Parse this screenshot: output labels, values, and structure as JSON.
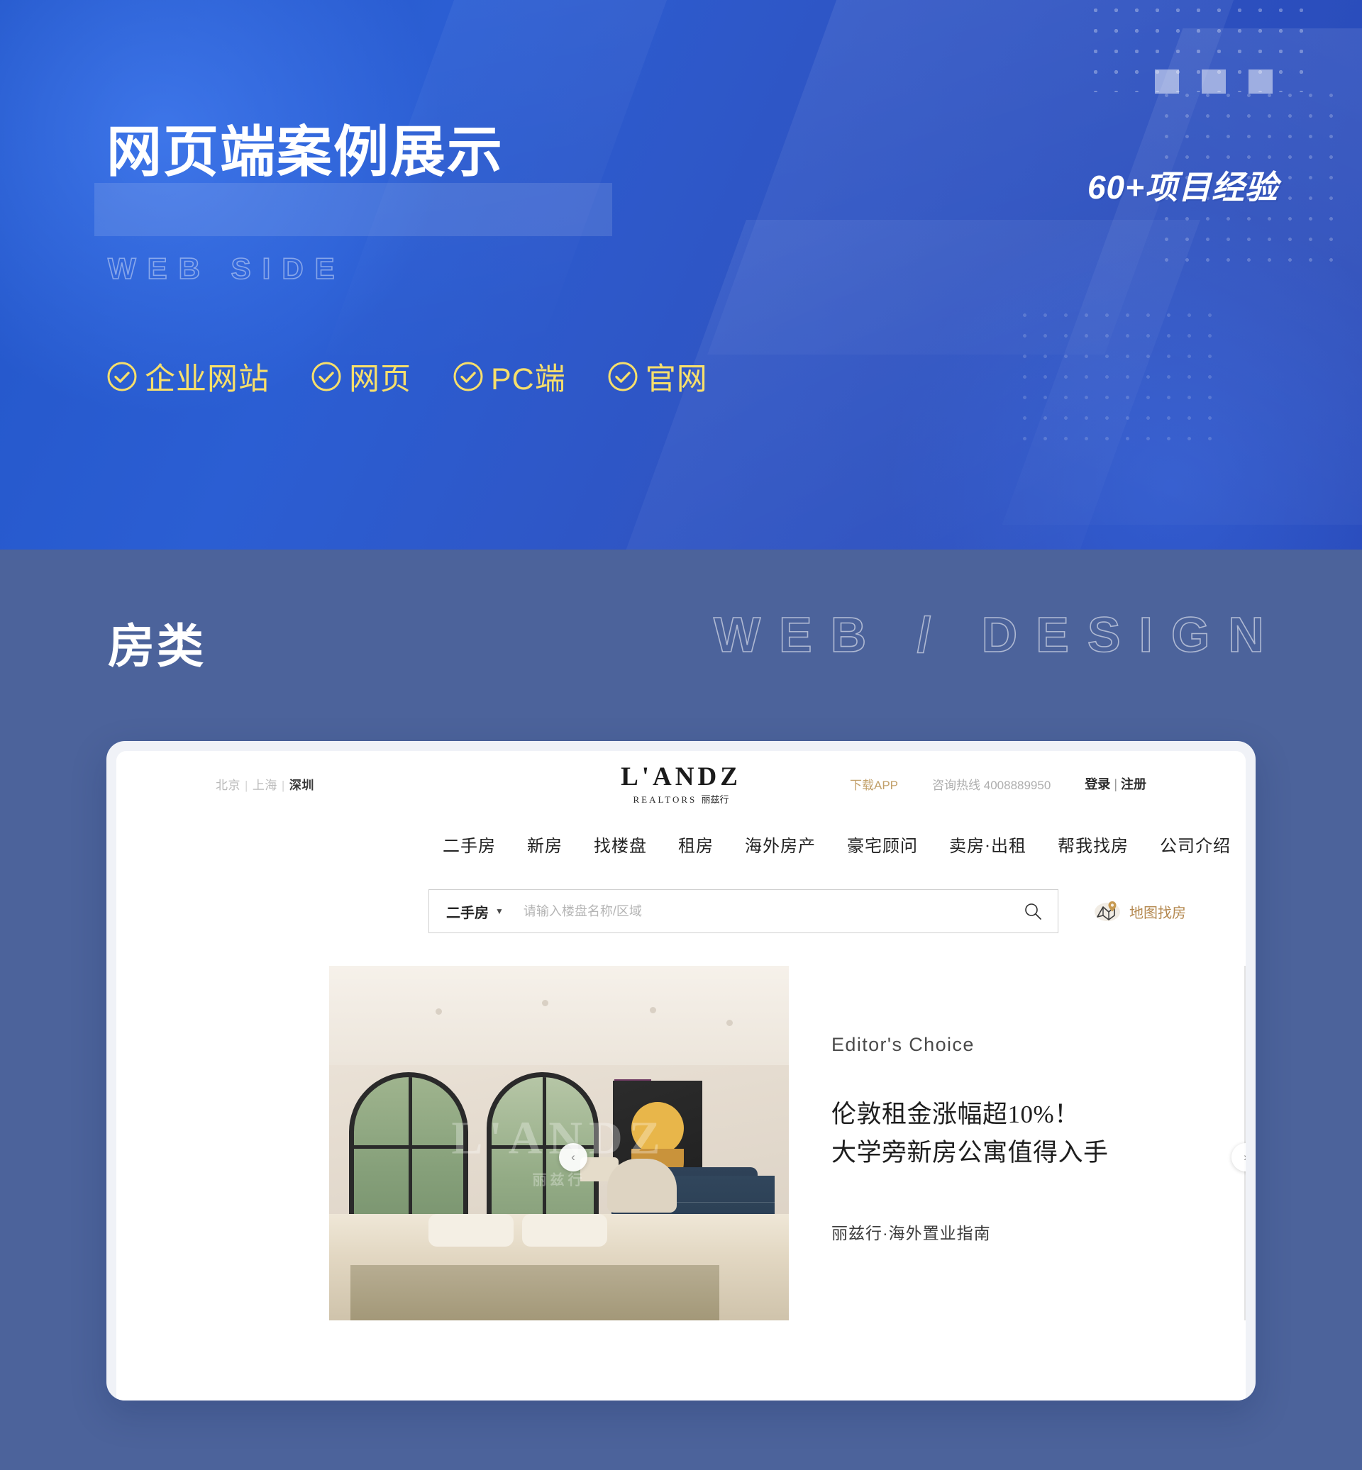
{
  "hero": {
    "title": "网页端案例展示",
    "subtitle": "WEB SIDE",
    "badge": "60+项目经验",
    "features": [
      {
        "label": "企业网站",
        "icon": "check-circle-icon"
      },
      {
        "label": "网页",
        "icon": "check-circle-icon"
      },
      {
        "label": "PC端",
        "icon": "check-circle-icon"
      },
      {
        "label": "官网",
        "icon": "check-circle-icon"
      }
    ],
    "accent_color": "#F7DF6B",
    "background_color": "#2b5ed3"
  },
  "section2": {
    "title": "房类",
    "wordmark": "WEB / DESIGN",
    "background_color": "#4c639b"
  },
  "site": {
    "topbar": {
      "cities": [
        "北京",
        "上海",
        "深圳"
      ],
      "active_city": "深圳",
      "separator": "|",
      "download_app": "下载APP",
      "hotline": "咨询热线 4008889950",
      "login": "登录",
      "auth_separator": "|",
      "register": "注册",
      "gold_color": "#c2a06a"
    },
    "logo": {
      "main": "L'ANDZ",
      "sub_en": "REALTORS",
      "sub_cn": "丽兹行"
    },
    "nav": [
      "二手房",
      "新房",
      "找楼盘",
      "租房",
      "海外房产",
      "豪宅顾问",
      "卖房·出租",
      "帮我找房",
      "公司介绍"
    ],
    "search": {
      "selected_type": "二手房",
      "caret": "▼",
      "placeholder": "请输入楼盘名称/区域",
      "value": "",
      "search_icon": "magnifier-icon",
      "map_link_label": "地图找房",
      "map_link_icon": "map-pin-icon"
    },
    "banner": {
      "photo_watermark": "L'ANDZ",
      "photo_watermark_sub": "丽兹行",
      "eyebrow": "Editor's Choice",
      "headline_line1": "伦敦租金涨幅超10%！",
      "headline_line2": "大学旁新房公寓值得入手",
      "note": "丽兹行·海外置业指南",
      "prev_arrow": "‹",
      "next_arrow": "›"
    }
  }
}
